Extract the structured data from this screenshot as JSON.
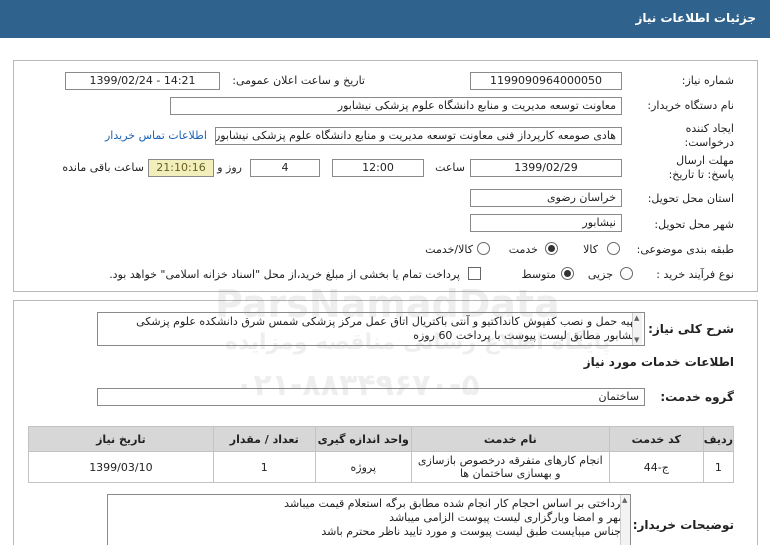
{
  "header": {
    "title": "جزئیات اطلاعات نیاز"
  },
  "info": {
    "need_number_label": "شماره نیاز:",
    "need_number": "1199090964000050",
    "announce_label": "تاریخ و ساعت اعلان عمومی:",
    "announce_value": "1399/02/24 - 14:21",
    "buyer_org_label": "نام دستگاه خریدار:",
    "buyer_org": "معاونت توسعه مدیریت و منابع دانشگاه علوم پزشکی نیشابور",
    "creator_label": "ایجاد کننده درخواست:",
    "creator": "هادی صومعه کارپرداز فنی معاونت توسعه مدیریت و منابع دانشگاه علوم پزشکی نیشابور",
    "contact_link": "اطلاعات تماس خریدار",
    "deadline_label": "مهلت ارسال پاسخ: تا تاریخ:",
    "deadline_date": "1399/02/29",
    "time_label": "ساعت",
    "deadline_time": "12:00",
    "days_value": "4",
    "days_label": "روز و",
    "remaining_time": "21:10:16",
    "remaining_label": "ساعت باقی مانده",
    "province_label": "استان محل تحویل:",
    "province": "خراسان رضوی",
    "city_label": "شهر محل تحویل:",
    "city": "نیشابور",
    "category_label": "طبقه بندی موضوعی:",
    "category_options": [
      "کالا",
      "خدمت",
      "کالا/خدمت"
    ],
    "category_selected": "خدمت",
    "process_label": "نوع فرآیند خرید :",
    "process_options": [
      "جزیی",
      "متوسط"
    ],
    "process_selected": "متوسط",
    "payment_note": "پرداخت تمام یا بخشی از مبلغ خرید،از محل \"اسناد خزانه اسلامی\" خواهد بود."
  },
  "description": {
    "label": "شرح کلی نیاز:",
    "text": "تهیه حمل و  نصب کفپوش کانداکتیو و آنتی باکتریال اتاق عمل مرکز پزشکی شمس شرق دانشکده علوم پزشکی نیشابور مطابق لیست پیوست با پرداخت 60 روزه"
  },
  "services": {
    "section_title": "اطلاعات خدمات مورد نیاز",
    "group_label": "گروه خدمت:",
    "group_value": "ساختمان",
    "columns": [
      "ردیف",
      "کد خدمت",
      "نام خدمت",
      "واحد اندازه گیری",
      "تعداد / مقدار",
      "تاریخ نیاز"
    ],
    "rows": [
      {
        "index": "1",
        "code": "ج-44",
        "name": "انجام کارهای متفرقه درخصوص بازسازی و بهسازی ساختمان ها",
        "unit": "پروژه",
        "qty": "1",
        "date": "1399/03/10"
      }
    ]
  },
  "buyer_notes": {
    "label": "توضیحات خریدار:",
    "lines": [
      "پرداختی بر اساس احجام کار انجام شده مطابق برگه استعلام قیمت میباشد",
      "مهر و امضا وبارگزاری لیست پیوست الزامی میباشد",
      "اجناس میبایست طبق لیست پیوست و مورد تایید ناظر محترم باشد"
    ]
  },
  "watermark": {
    "line1": "ParsNamadData",
    "line2": "پایگاه اطلاع رسانی مناقصه ومزایده",
    "line3": "۰۲۱-۸۸۳۴۹۶۷۰-۵"
  }
}
